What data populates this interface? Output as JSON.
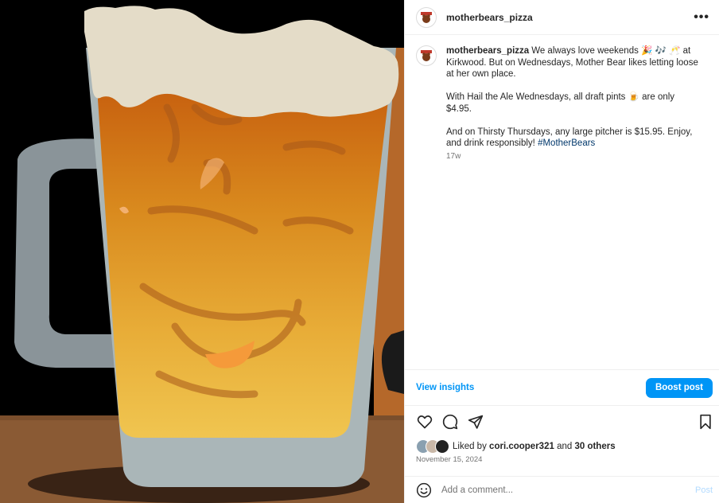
{
  "post": {
    "username": "motherbears_pizza",
    "more_icon": "more-horizontal-icon"
  },
  "caption": {
    "username": "motherbears_pizza",
    "line1": "We always love weekends 🎉 🎶 🥂 at Kirkwood. But on Wednesdays, Mother Bear likes letting loose at her own place.",
    "line2": "With Hail the Ale Wednesdays, all draft pints 🍺 are only $4.95.",
    "line3": "And on Thirsty Thursdays, any large pitcher is $15.95. Enjoy, and drink responsibly!",
    "hashtag": "#MotherBears",
    "age": "17w"
  },
  "insights": {
    "view_label": "View insights",
    "boost_label": "Boost post"
  },
  "actions": {
    "like_icon": "heart-icon",
    "comment_icon": "comment-icon",
    "share_icon": "share-icon",
    "save_icon": "bookmark-icon"
  },
  "likes": {
    "prefix": "Liked by",
    "user": "cori.cooper321",
    "joiner": "and",
    "others": "30 others"
  },
  "date": "November 15, 2024",
  "comment": {
    "placeholder": "Add a comment...",
    "post_label": "Post"
  },
  "colors": {
    "accent": "#0095f6",
    "link": "#00376b",
    "muted": "#737373"
  }
}
